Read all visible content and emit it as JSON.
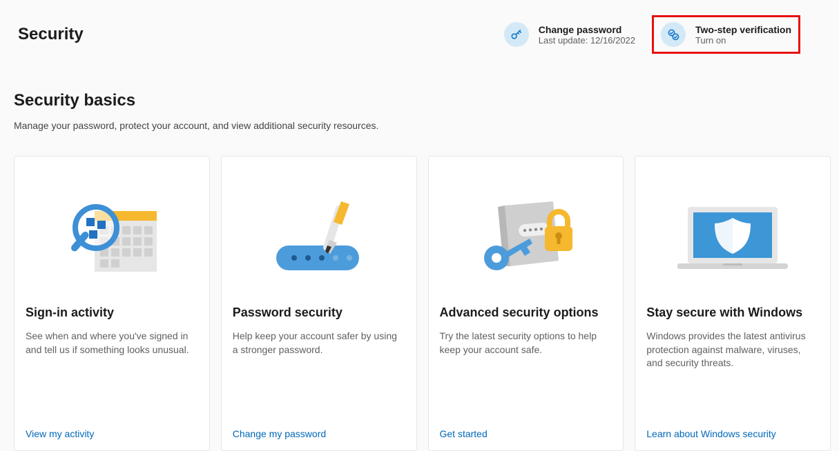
{
  "header": {
    "title": "Security",
    "actions": [
      {
        "title": "Change password",
        "subtitle": "Last update: 12/16/2022",
        "icon": "key-icon",
        "highlighted": false
      },
      {
        "title": "Two-step verification",
        "subtitle": "Turn on",
        "icon": "two-step-icon",
        "highlighted": true
      }
    ]
  },
  "section": {
    "title": "Security basics",
    "description": "Manage your password, protect your account, and view additional security resources."
  },
  "cards": [
    {
      "title": "Sign-in activity",
      "description": "See when and where you've signed in and tell us if something looks unusual.",
      "link": "View my activity"
    },
    {
      "title": "Password security",
      "description": "Help keep your account safer by using a stronger password.",
      "link": "Change my password"
    },
    {
      "title": "Advanced security options",
      "description": "Try the latest security options to help keep your account safe.",
      "link": "Get started"
    },
    {
      "title": "Stay secure with Windows",
      "description": "Windows provides the latest antivirus protection against malware, viruses, and security threats.",
      "link": "Learn about Windows security"
    }
  ]
}
